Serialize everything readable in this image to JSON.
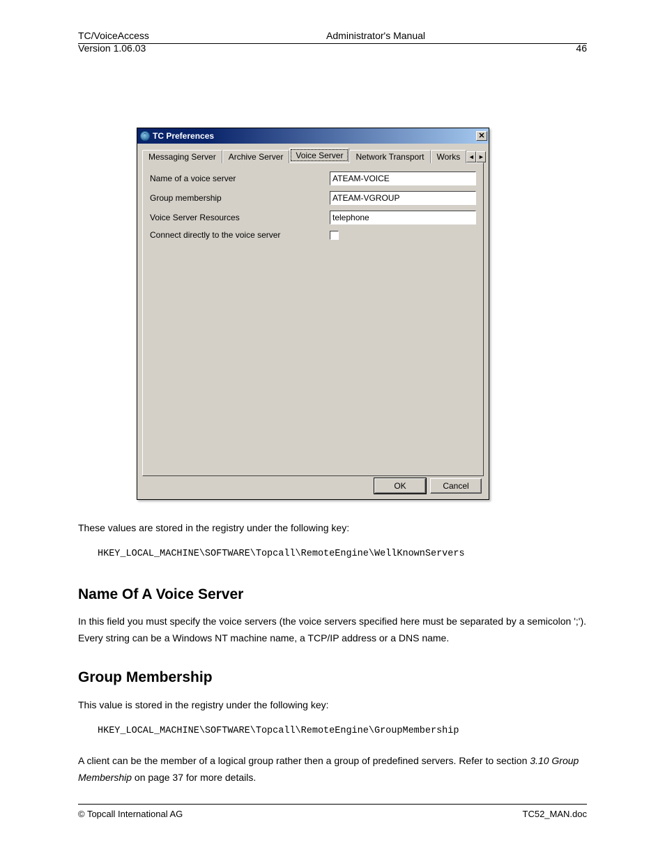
{
  "header": {
    "product": "TC/VoiceAccess",
    "doctitle": "Administrator's Manual",
    "version": "Version 1.06.03",
    "pagenum": "46"
  },
  "window": {
    "title": "TC Preferences",
    "close_glyph": "✕",
    "tabs": [
      "Messaging Server",
      "Archive Server",
      "Voice Server",
      "Network Transport",
      "Works"
    ],
    "scroll_left": "◄",
    "scroll_right": "►",
    "fields": {
      "name_label": "Name of a voice server",
      "name_value": "ATEAM-VOICE",
      "group_label": "Group membership",
      "group_value": "ATEAM-VGROUP",
      "resources_label": "Voice Server Resources",
      "resources_value": "telephone",
      "connect_label": "Connect directly to the voice server"
    },
    "ok_label": "OK",
    "cancel_label": "Cancel"
  },
  "body": {
    "p1": "These values are stored in the registry under the following key:",
    "reg1": "HKEY_LOCAL_MACHINE\\SOFTWARE\\Topcall\\RemoteEngine\\WellKnownServers",
    "h1": "Name Of A Voice Server",
    "p2": "In this field you must specify the voice servers (the voice servers specified here must be separated by a semicolon ';'). Every string can be a Windows NT machine name, a TCP/IP address or a DNS name.",
    "h2": "Group Membership",
    "p3": "This value is stored in the registry under the following key:",
    "reg2": "HKEY_LOCAL_MACHINE\\SOFTWARE\\Topcall\\RemoteEngine\\GroupMembership",
    "p4a": "A client can be the member of a logical group rather then a group of predefined servers. Refer to section",
    "p4link": "3.10 Group Membership",
    "p4b": " on page 37 for more details.",
    "footer_left": "© Topcall International AG",
    "footer_right": "TC52_MAN.doc"
  }
}
